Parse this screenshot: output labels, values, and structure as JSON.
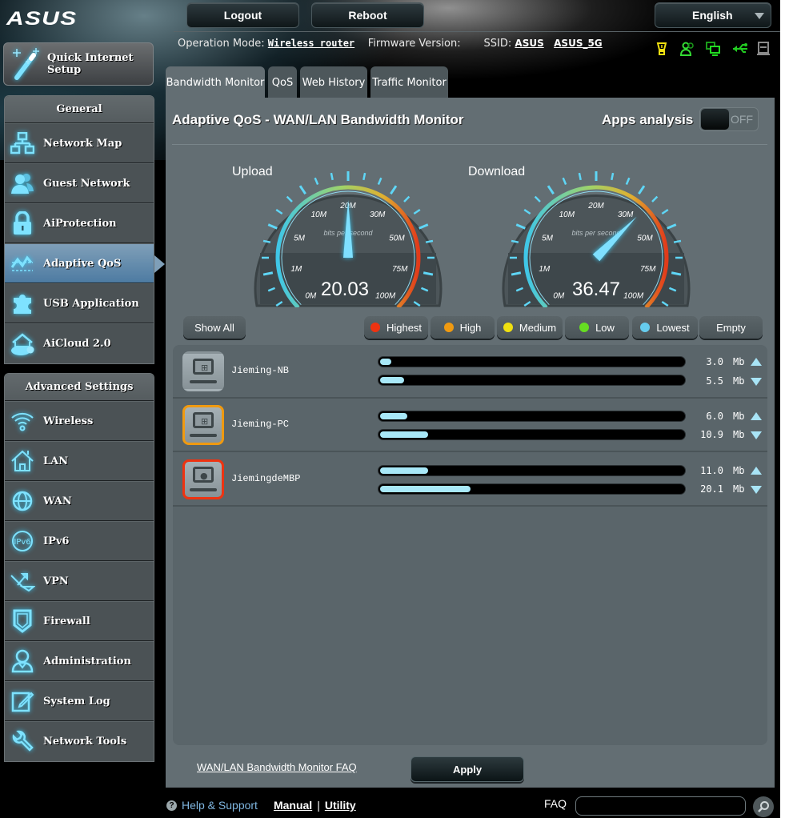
{
  "brand": {
    "logo": "/ISUS"
  },
  "header": {
    "logout_label": "Logout",
    "reboot_label": "Reboot",
    "language": "English",
    "operation_mode_label": "Operation Mode:",
    "operation_mode_value": "Wireless router",
    "firmware_label": "Firmware Version:",
    "firmware_value": "",
    "ssid_label": "SSID:",
    "ssid_values": [
      "ASUS",
      "ASUS_5G"
    ],
    "status_icons": [
      {
        "name": "internet-status-icon",
        "color": "#f0e010"
      },
      {
        "name": "clients-status-icon",
        "color": "#33dd33"
      },
      {
        "name": "lan-status-icon",
        "color": "#22cc22"
      },
      {
        "name": "usb-status-icon",
        "color": "#22cc22"
      },
      {
        "name": "printer-status-icon",
        "color": "#8a8a8a"
      }
    ]
  },
  "sidebar": {
    "quick_setup_label": "Quick Internet Setup",
    "general": {
      "title": "General",
      "items": [
        {
          "label": "Network Map",
          "icon": "network-map-icon"
        },
        {
          "label": "Guest Network",
          "icon": "guest-network-icon"
        },
        {
          "label": "AiProtection",
          "icon": "lock-icon"
        },
        {
          "label": "Adaptive QoS",
          "icon": "qos-chart-icon",
          "active": true
        },
        {
          "label": "USB Application",
          "icon": "puzzle-icon"
        },
        {
          "label": "AiCloud 2.0",
          "icon": "cloud-home-icon"
        }
      ]
    },
    "advanced": {
      "title": "Advanced Settings",
      "items": [
        {
          "label": "Wireless",
          "icon": "wifi-icon"
        },
        {
          "label": "LAN",
          "icon": "home-icon"
        },
        {
          "label": "WAN",
          "icon": "globe-icon"
        },
        {
          "label": "IPv6",
          "icon": "ipv6-globe-icon"
        },
        {
          "label": "VPN",
          "icon": "vpn-icon"
        },
        {
          "label": "Firewall",
          "icon": "shield-icon"
        },
        {
          "label": "Administration",
          "icon": "admin-user-icon"
        },
        {
          "label": "System Log",
          "icon": "log-edit-icon"
        },
        {
          "label": "Network Tools",
          "icon": "wrench-icon"
        }
      ]
    }
  },
  "tabs": [
    {
      "label": "Bandwidth Monitor",
      "active": true
    },
    {
      "label": "QoS"
    },
    {
      "label": "Web History"
    },
    {
      "label": "Traffic Monitor"
    }
  ],
  "main": {
    "title": "Adaptive QoS - WAN/LAN Bandwidth Monitor",
    "apps_analysis_label": "Apps analysis",
    "apps_analysis_state": "OFF",
    "gauges": {
      "upload": {
        "label": "Upload",
        "value": "20.03",
        "value_num": 20.03
      },
      "download": {
        "label": "Download",
        "value": "36.47",
        "value_num": 36.47
      },
      "scale_labels": [
        "0M",
        "1M",
        "5M",
        "10M",
        "20M",
        "30M",
        "50M",
        "75M",
        "100M"
      ],
      "unit_caption": "bits per second"
    },
    "filters": {
      "show_all": "Show All",
      "priorities": [
        {
          "label": "Highest",
          "color": "#ee3311"
        },
        {
          "label": "High",
          "color": "#f09a10"
        },
        {
          "label": "Medium",
          "color": "#f0e010"
        },
        {
          "label": "Low",
          "color": "#66dd22"
        },
        {
          "label": "Lowest",
          "color": "#66ccee"
        }
      ],
      "empty": "Empty"
    },
    "clients": [
      {
        "name": "Jieming-NB",
        "os": "windows",
        "priority_color": "",
        "up": "3.0",
        "down": "5.5",
        "unit": "Mb",
        "up_fraction": 0.03,
        "down_fraction": 0.08
      },
      {
        "name": "Jieming-PC",
        "os": "windows",
        "priority_color": "#f09a10",
        "up": "6.0",
        "down": "10.9",
        "unit": "Mb",
        "up_fraction": 0.09,
        "down_fraction": 0.16
      },
      {
        "name": "JiemingdeMBP",
        "os": "apple",
        "priority_color": "#ee3311",
        "up": "11.0",
        "down": "20.1",
        "unit": "Mb",
        "up_fraction": 0.16,
        "down_fraction": 0.3
      }
    ],
    "faq_link": "WAN/LAN Bandwidth Monitor FAQ",
    "apply_label": "Apply"
  },
  "footer": {
    "help_label": "Help & Support",
    "manual_label": "Manual",
    "separator": "|",
    "utility_label": "Utility",
    "faq_label": "FAQ",
    "faq_placeholder": ""
  }
}
